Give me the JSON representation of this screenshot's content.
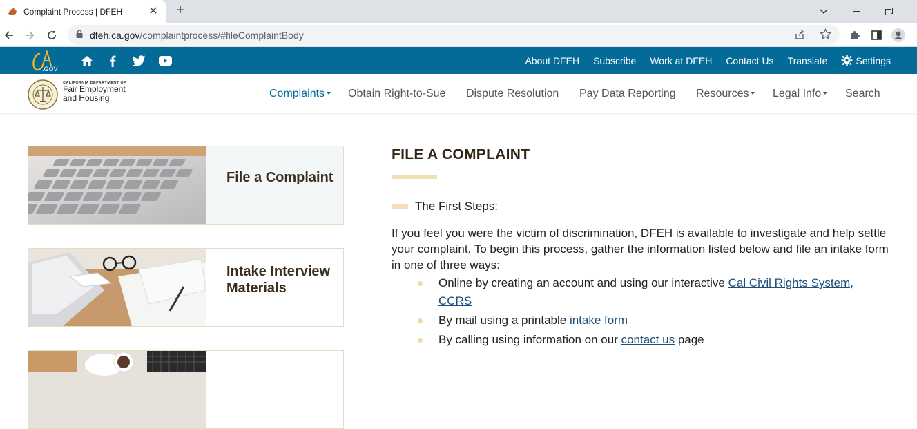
{
  "browser": {
    "tab_title": "Complaint Process | DFEH",
    "url_host": "dfeh.ca.gov",
    "url_path": "/complaintprocess/#fileComplaintBody"
  },
  "topbar": {
    "logo_text": "CA.GOV",
    "links": [
      "About DFEH",
      "Subscribe",
      "Work at DFEH",
      "Contact Us",
      "Translate",
      "Settings"
    ],
    "accent": "#046b99"
  },
  "org": {
    "dept": "CALIFORNIA DEPARTMENT OF",
    "line1": "Fair Employment",
    "line2": "and Housing"
  },
  "nav": {
    "items": [
      {
        "label": "Complaints",
        "has_caret": true
      },
      {
        "label": "Obtain Right-to-Sue",
        "has_caret": false
      },
      {
        "label": "Dispute Resolution",
        "has_caret": false
      },
      {
        "label": "Pay Data Reporting",
        "has_caret": false
      },
      {
        "label": "Resources",
        "has_caret": true
      },
      {
        "label": "Legal Info",
        "has_caret": true
      },
      {
        "label": "Search",
        "has_caret": false
      }
    ]
  },
  "cards": [
    {
      "label": "File a Complaint"
    },
    {
      "label": "Intake Interview Materials"
    }
  ],
  "main": {
    "heading": "FILE A COMPLAINT",
    "steps_label": "The First Steps:",
    "intro": "If you feel you were the victim of discrimination, DFEH is available to investigate and help settle your complaint. To begin this process, gather the information listed below and file an intake form in one of three ways:",
    "bullets": [
      {
        "before": "Online by creating an account and using our interactive ",
        "link": "Cal Civil Rights System, CCRS",
        "after": ""
      },
      {
        "before": "By mail using a printable ",
        "link": "intake form",
        "after": ""
      },
      {
        "before": "By calling using information on our ",
        "link": "contact us",
        "after": " page"
      }
    ]
  }
}
